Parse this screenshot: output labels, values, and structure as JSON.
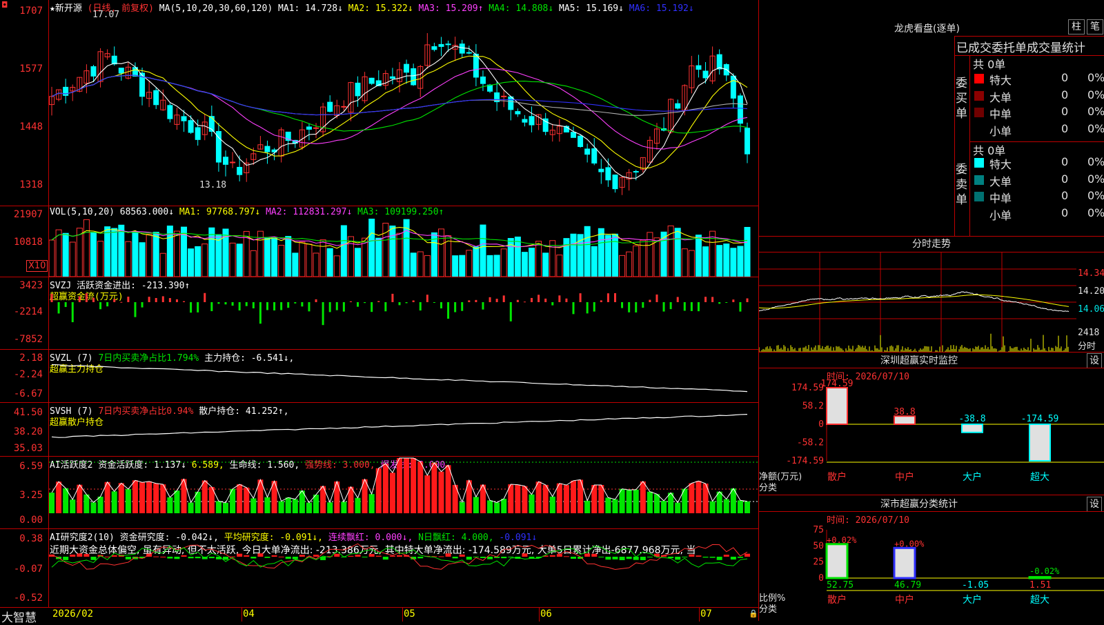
{
  "kline": {
    "title": "★新开源",
    "period": "(日线, 前复权)",
    "ma_label": "MA(5,10,20,30,60,120)",
    "ma1": "MA1: 14.728↓",
    "ma2": "MA2: 15.322↓",
    "ma3": "MA3: 15.209↑",
    "ma4": "MA4: 14.808↓",
    "ma5": "MA5: 15.169↓",
    "ma6": "MA6: 15.192↓",
    "high_mark": "17.07",
    "low_mark": "13.18",
    "y_labels": [
      "1707",
      "1577",
      "1448",
      "1318"
    ]
  },
  "vol": {
    "label": "VOL(5,10,20)",
    "value": "68563.000↓",
    "ma1": "MA1: 97768.797↓",
    "ma2": "MA2: 112831.297↓",
    "ma3": "MA3: 109199.250↑",
    "y_labels": [
      "21907",
      "10818"
    ],
    "unit": "X10"
  },
  "svzj": {
    "label": "SVZJ",
    "item": "活跃资金进出: -213.390↑",
    "name": "超赢资金流(万元)",
    "y_labels": [
      "3423",
      "-2214",
      "-7852"
    ]
  },
  "svzl": {
    "label": "SVZL (7)",
    "item1": "7日内买卖净占比1.794%",
    "item2": "主力持仓: -6.541↓,",
    "name": "超赢主力持仓",
    "y_labels": [
      "2.18",
      "-2.24",
      "-6.67"
    ]
  },
  "svsh": {
    "label": "SVSH (7)",
    "item1": "7日内买卖净占比0.94%",
    "item2": "散户持仓: 41.252↑,",
    "name": "超赢散户持仓",
    "y_labels": [
      "41.50",
      "38.20",
      "35.03"
    ]
  },
  "ai_active": {
    "label": "AI活跃度2",
    "item1": "资金活跃度: 1.137↓",
    "item2": "6.589,",
    "item3": "生命线: 1.560,",
    "item4": "强势线: 3.000,",
    "item5": "爆发线: 6.000,",
    "y_labels": [
      "6.59",
      "3.25",
      "0.00"
    ]
  },
  "ai_research": {
    "label": "AI研究度2(10)",
    "item1": "资金研究度: -0.042↓,",
    "item2": "平均研究度: -0.091↓,",
    "item3": "连续飘红: 0.000↓,",
    "item4": "N日飘红: 4.000,",
    "item5": "-0.091↓",
    "comment": "近期大资金总体偏空, 虽有异动, 但不太活跃, 今日大单净流出: -213.386万元, 其中特大单净流出: -174.589万元, 大单5日累计净出-6877.968万元, 当",
    "y_labels": [
      "0.38",
      "-0.07",
      "-0.52"
    ]
  },
  "time_axis": {
    "brand": "大智慧",
    "dates": [
      "2026/02",
      "04",
      "05",
      "06",
      "07"
    ]
  },
  "right": {
    "dragon_title": "龙虎看盘(逐单)",
    "btn_zhu": "柱",
    "btn_bi": "笔",
    "stat_title": "已成交委托单成交量统计",
    "buy_side": "委买单",
    "sell_side": "委卖单",
    "buy_total": "共 0单",
    "sell_total": "共 0单",
    "buy_rows": [
      {
        "name": "特大",
        "count": "0",
        "pct": "0%",
        "color": "#ff0000"
      },
      {
        "name": "大单",
        "count": "0",
        "pct": "0%",
        "color": "#8b0000"
      },
      {
        "name": "中单",
        "count": "0",
        "pct": "0%",
        "color": "#700000"
      },
      {
        "name": "小单",
        "count": "0",
        "pct": "0%",
        "color": "#000000"
      }
    ],
    "sell_rows": [
      {
        "name": "特大",
        "count": "0",
        "pct": "0%",
        "color": "#00ffff"
      },
      {
        "name": "大单",
        "count": "0",
        "pct": "0%",
        "color": "#008080"
      },
      {
        "name": "中单",
        "count": "0",
        "pct": "0%",
        "color": "#007070"
      },
      {
        "name": "小单",
        "count": "0",
        "pct": "0%",
        "color": "#000000"
      }
    ],
    "minute_title": "分时走势",
    "minute_prices": [
      "14.34",
      "14.20",
      "14.06"
    ],
    "minute_vol": "2418",
    "minute_vol_unit": "分时",
    "sz_title": "深圳超赢实时监控",
    "sz_btn": "设",
    "sz_time": "时间: 2026/07/10",
    "sz_y": [
      "174.59",
      "58.2",
      "0",
      "-58.2",
      "-174.59"
    ],
    "sz_axis_label": "净额(万元)",
    "sz_axis_label2": "分类",
    "sz_categories": [
      "散户",
      "中户",
      "大户",
      "超大"
    ],
    "sz_values": [
      "174.59",
      "38.8",
      "-38.8",
      "-174.59"
    ],
    "sc_title": "深市超赢分类统计",
    "sc_btn": "设",
    "sc_time": "时间: 2026/07/10",
    "sc_y": [
      "75",
      "50",
      "25",
      "0"
    ],
    "sc_axis_label": "比例%",
    "sc_axis_label2": "分类",
    "sc_categories": [
      "散户",
      "中户",
      "大户",
      "超大"
    ],
    "sc_top": [
      "+0.02%",
      "+0.00%",
      "",
      "-0.02%"
    ],
    "sc_values": [
      "52.75",
      "46.79",
      "-1.05",
      "1.51"
    ]
  },
  "chart_data": {
    "type": "bar",
    "title": "深圳超赢实时监控",
    "categories": [
      "散户",
      "中户",
      "大户",
      "超大"
    ],
    "values": [
      174.59,
      38.8,
      -38.8,
      -174.59
    ],
    "ylabel": "净额(万元)",
    "ylim": [
      -174.59,
      174.59
    ]
  }
}
